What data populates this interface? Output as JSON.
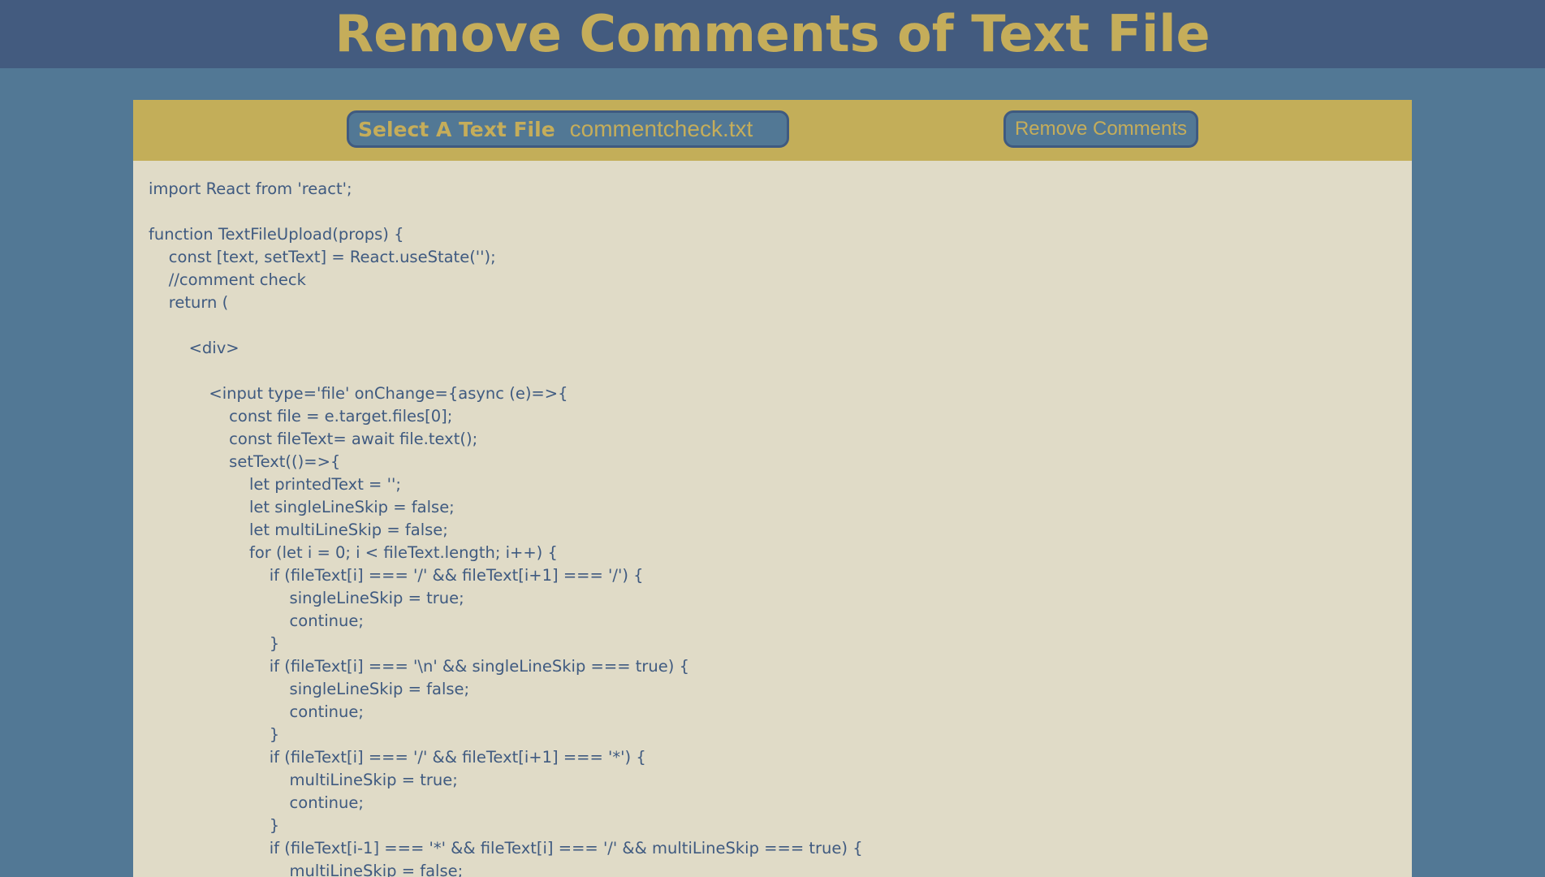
{
  "header": {
    "title": "Remove Comments of Text File"
  },
  "toolbar": {
    "select_label": "Select A Text File",
    "file_name": "commentcheck.txt",
    "remove_label": "Remove Comments"
  },
  "editor": {
    "lines": [
      "import React from 'react';",
      "",
      "function TextFileUpload(props) {",
      "    const [text, setText] = React.useState('');",
      "    //comment check",
      "    return (",
      "",
      "        <div>",
      "",
      "            <input type='file' onChange={async (e)=>{",
      "                const file = e.target.files[0];",
      "                const fileText= await file.text();",
      "                setText(()=>{",
      "                    let printedText = '';",
      "                    let singleLineSkip = false;",
      "                    let multiLineSkip = false;",
      "                    for (let i = 0; i < fileText.length; i++) {",
      "                        if (fileText[i] === '/' && fileText[i+1] === '/') {",
      "                            singleLineSkip = true;",
      "                            continue;",
      "                        }",
      "                        if (fileText[i] === '\\n' && singleLineSkip === true) {",
      "                            singleLineSkip = false;",
      "                            continue;",
      "                        }",
      "                        if (fileText[i] === '/' && fileText[i+1] === '*') {",
      "                            multiLineSkip = true;",
      "                            continue;",
      "                        }",
      "                        if (fileText[i-1] === '*' && fileText[i] === '/' && multiLineSkip === true) {",
      "                            multiLineSkip = false;"
    ]
  },
  "colors": {
    "background": "#527895",
    "header_bg": "#435b7f",
    "accent_gold": "#c5ad5a",
    "toolbar_bg": "#c3ae59",
    "panel_bg": "#e0dbc7",
    "code_text": "#3f5a80"
  }
}
